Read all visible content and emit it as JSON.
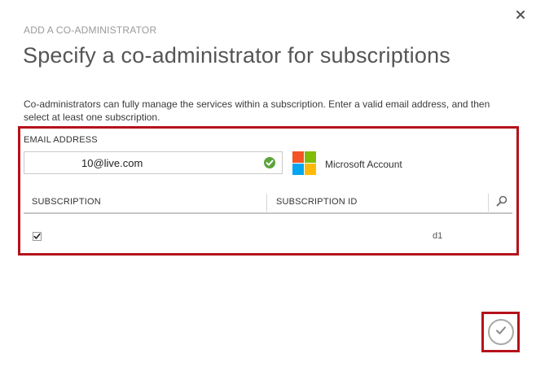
{
  "dialog": {
    "eyebrow": "ADD A CO-ADMINISTRATOR",
    "title": "Specify a co-administrator for subscriptions",
    "description": "Co-administrators can fully manage the services within a subscription. Enter a valid email address, and then select at least one subscription."
  },
  "email": {
    "label": "EMAIL ADDRESS",
    "value": "10@live.com",
    "valid": true,
    "account_type": "Microsoft Account"
  },
  "table": {
    "columns": [
      "SUBSCRIPTION",
      "SUBSCRIPTION ID"
    ],
    "rows": [
      {
        "checked": true,
        "subscription": "",
        "subscription_id": "d1"
      }
    ]
  },
  "icons": {
    "close": "close-icon",
    "valid": "checkmark-circle-icon",
    "search": "search-icon",
    "confirm": "checkmark-icon",
    "brand": "microsoft-logo-icon"
  },
  "colors": {
    "highlight": "#b5121b",
    "valid_green": "#5ba43c",
    "ms_red": "#f35325",
    "ms_green": "#81bc06",
    "ms_blue": "#05a6f0",
    "ms_yellow": "#ffba08"
  }
}
